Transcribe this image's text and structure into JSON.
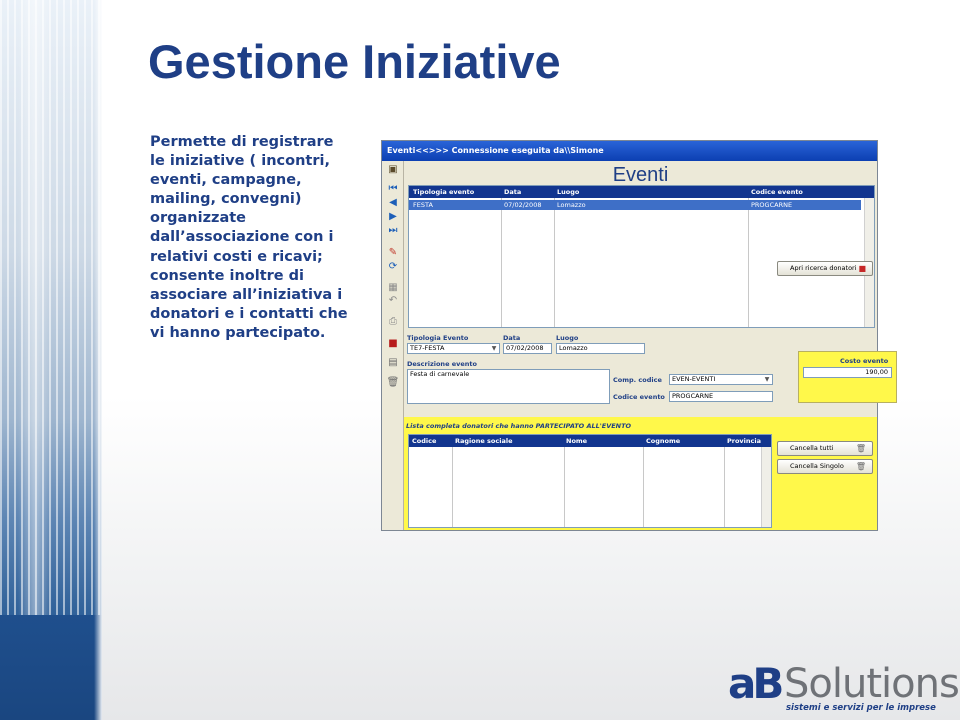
{
  "slide": {
    "title": "Gestione Iniziative",
    "description": "Permette di registrare le iniziative ( incontri, eventi, campagne, mailing, convegni) organizzate dall’associazione con i relativi costi e ricavi; consente inoltre di associare all’iniziativa i donatori e i contatti che vi hanno partecipato."
  },
  "window": {
    "title": "Eventi<<>>> Connessione eseguita da\\\\Simone",
    "header": "Eventi"
  },
  "toolbar": {
    "icons": [
      "exit-icon",
      "first-record-icon",
      "previous-record-icon",
      "next-record-icon",
      "last-record-icon",
      "edit-icon",
      "refresh-icon",
      "save-icon",
      "undo-icon",
      "print-icon",
      "report-icon",
      "notes-icon",
      "delete-icon"
    ]
  },
  "events_grid": {
    "columns": [
      "Tipologia evento",
      "Data",
      "Luogo",
      "Codice evento"
    ],
    "rows": [
      {
        "tipologia": "FESTA",
        "data": "07/02/2008",
        "luogo": "Lomazzo",
        "codice": "PROGCARNE"
      }
    ]
  },
  "form": {
    "tipologia_label": "Tipologia Evento",
    "tipologia_value": "TE7-FESTA",
    "data_label": "Data",
    "data_value": "07/02/2008",
    "luogo_label": "Luogo",
    "luogo_value": "Lomazzo",
    "descrizione_label": "Descrizione evento",
    "descrizione_value": "Festa di carnevale",
    "comp_codice_label": "Comp. codice",
    "comp_codice_value": "EVEN-EVENTI",
    "codice_evento_label": "Codice evento",
    "codice_evento_value": "PROGCARNE",
    "costo_evento_label": "Costo evento",
    "costo_evento_value": "190,00"
  },
  "donors": {
    "caption": "Lista completa donatori che hanno PARTECIPATO ALL'EVENTO",
    "columns": [
      "Codice",
      "Ragione sociale",
      "Nome",
      "Cognome",
      "Provincia"
    ],
    "buttons": {
      "apri": "Apri ricerca donatori",
      "cancella_tutti": "Cancella tutti",
      "cancella_singolo": "Cancella Singolo"
    }
  },
  "logo": {
    "mark": "aB",
    "word": "Solutions",
    "tagline": "sistemi e servizi per le imprese"
  },
  "colors": {
    "title_blue": "#1f3f86",
    "grid_header": "#12358f",
    "selected_row": "#3e6fc7",
    "panel_yellow": "#fff84a",
    "window_bg": "#ece9d8"
  }
}
